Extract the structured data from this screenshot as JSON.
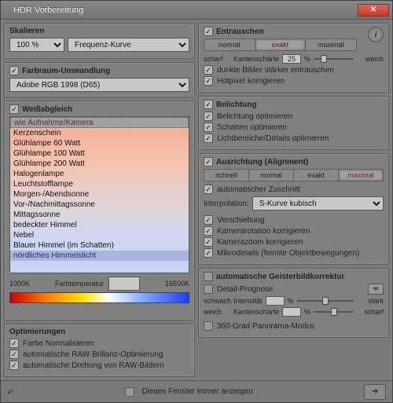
{
  "title": "HDR Vorbereitung",
  "scale": {
    "heading": "Skalieren",
    "value": "100 %",
    "curve": "Frequenz-Kurve"
  },
  "colorspace": {
    "heading": "Farbraum-Umwandlung",
    "value": "Adobe RGB 1998 (D65)"
  },
  "wb": {
    "heading": "Weißabgleich",
    "items": [
      "wie Aufnahme/Kamera",
      "Kerzenschein",
      "Glühlampe 60 Watt",
      "Glühlampe 100 Watt",
      "Glühlampe 200 Watt",
      "Halogenlampe",
      "Leuchtstofflampe",
      "Morgen-/Abendsonne",
      "Vor-/Nachmittagssonne",
      "Mittagssonne",
      "bedeckter Himmel",
      "Nebel",
      "Blauer Himmel (im Schatten)",
      "nördliches Himmelslicht"
    ],
    "temp_label": "Farbtemperatur",
    "k_low": "1000K",
    "k_high": "16500K"
  },
  "opt": {
    "heading": "Optimierungen",
    "items": [
      "Farbe Normalisieren",
      "automatische RAW Brillanz-Optimierung",
      "automatische Drehung von RAW-Bildern"
    ]
  },
  "denoise": {
    "heading": "Entrauschen",
    "normal": "normal",
    "exact": "exakt",
    "max": "maximal",
    "sharp_l": "scharf",
    "sharp_mid": "Kantenschärfe",
    "sharp_val": "25",
    "sharp_pct": "%",
    "sharp_r": "weich",
    "c1": "dunkle Bilder stärker entrauschen",
    "c2": "Hotpixel korrigieren"
  },
  "exposure": {
    "heading": "Belichtung",
    "c1": "Belichtung optimieren",
    "c2": "Schatten optimieren",
    "c3": "Lichtbereiche/Details optimieren"
  },
  "align": {
    "heading": "Ausrichtung (Alignment)",
    "fast": "schnell",
    "normal": "normal",
    "exact": "exakt",
    "max": "maximal",
    "auto_crop": "automatischer Zuschnitt",
    "interp_label": "Interpolation:",
    "interp_value": "S-Kurve kubisch",
    "c1": "Verschiebung",
    "c2": "Kamerarotation korrigieren",
    "c3": "Kamerazoom korrigieren",
    "c4": "Mikrodetails (feinste Objektbewegungen)"
  },
  "ghost": {
    "heading": "automatische Geisterbildkorrektur",
    "detail": "Detail-Prognose",
    "int_l": "schwach",
    "int_mid": "Intensität",
    "int_r": "stark",
    "edge_l": "weich",
    "edge_mid": "Kantenschärfe",
    "edge_r": "scharf",
    "pano": "360-Grad Panorama-Modus"
  },
  "footer": {
    "always": "Dieses Fenster immer anzeigen"
  }
}
